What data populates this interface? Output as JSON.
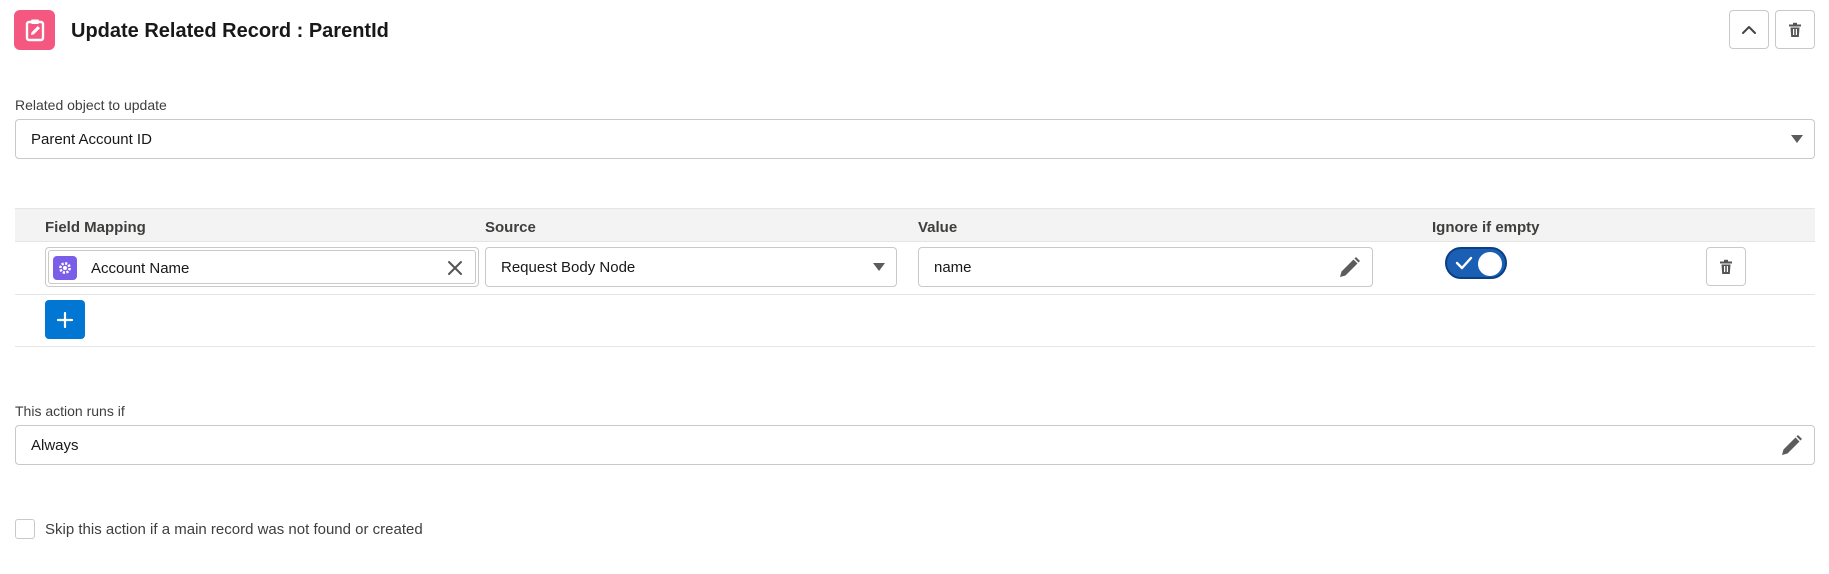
{
  "header": {
    "title": "Update Related Record : ParentId",
    "icon": "clipboard-edit-icon",
    "icon_color": "#f4577f"
  },
  "related_object": {
    "label": "Related object to update",
    "value": "Parent Account ID"
  },
  "mapping": {
    "columns": [
      "Field Mapping",
      "Source",
      "Value",
      "Ignore if empty"
    ],
    "rows": [
      {
        "field": "Account Name",
        "source": "Request Body Node",
        "value": "name",
        "ignore_if_empty": true
      }
    ]
  },
  "condition": {
    "label": "This action runs if",
    "value": "Always"
  },
  "skip_option": {
    "label": "Skip this action if a main record was not found or created",
    "checked": false
  },
  "colors": {
    "accent": "#0176d3",
    "toggle_on": "#1b5fb4",
    "field_icon": "#7b5ee8"
  }
}
